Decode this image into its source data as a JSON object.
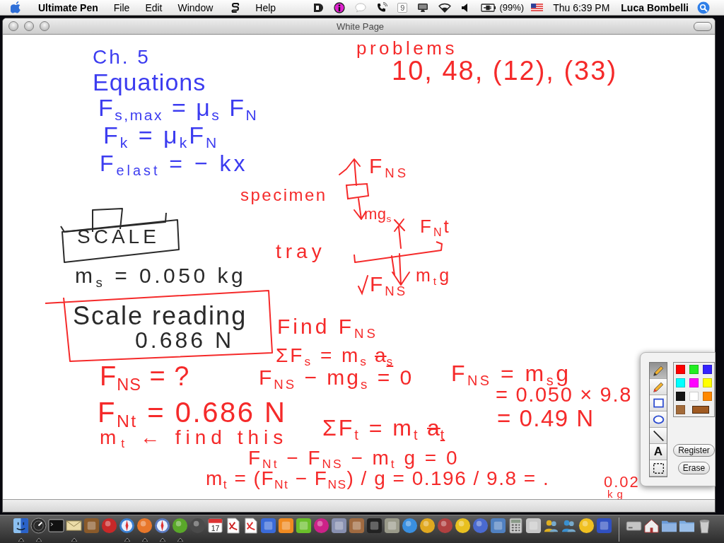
{
  "menu_bar": {
    "app_name": "Ultimate Pen",
    "menus": [
      {
        "kind": "text",
        "label": "File"
      },
      {
        "kind": "text",
        "label": "Edit"
      },
      {
        "kind": "text",
        "label": "Window"
      },
      {
        "kind": "script"
      },
      {
        "kind": "text",
        "label": "Help"
      }
    ],
    "status_items": [
      {
        "kind": "tab"
      },
      {
        "kind": "info"
      },
      {
        "kind": "bubble"
      },
      {
        "kind": "phone"
      },
      {
        "kind": "number",
        "glyph": "9"
      },
      {
        "kind": "display"
      },
      {
        "kind": "wifi"
      },
      {
        "kind": "volume"
      },
      {
        "kind": "battery",
        "label": "(99%)"
      },
      {
        "kind": "flag"
      }
    ],
    "clock": "Thu 6:39 PM",
    "user": "Luca Bombelli"
  },
  "window": {
    "title": "White Page"
  },
  "whiteboard": {
    "notes": [
      {
        "text": "Ch. 5",
        "color": "#3c3cf0",
        "struck": false
      },
      {
        "text": "problems",
        "color": "#f52a2a",
        "struck": false
      },
      {
        "text": "Equations",
        "color": "#3c3cf0",
        "struck": false
      },
      {
        "text": "10, 48, (12), (33)",
        "color": "#f52a2a",
        "struck": false
      },
      {
        "text": "F$_{s,max}$ = μ$_{s}$ F$_{N}$",
        "color": "#3c3cf0",
        "struck": false
      },
      {
        "text": "F$_{k}$ = μ$_{k}$F$_{N}$",
        "color": "#3c3cf0",
        "struck": false
      },
      {
        "text": "F$_{elast}$ = − kx",
        "color": "#3c3cf0",
        "struck": false
      },
      {
        "text": "F$_{NS}$",
        "color": "#f52a2a",
        "struck": false
      },
      {
        "text": "specimen",
        "color": "#f52a2a",
        "struck": false
      },
      {
        "text": "mg$_{s}$",
        "color": "#f52a2a",
        "struck": false
      },
      {
        "text": "SCALE",
        "color": "#2a2a2a",
        "struck": false
      },
      {
        "text": "F$_{N}$t",
        "color": "#f52a2a",
        "struck": false
      },
      {
        "text": "tray",
        "color": "#f52a2a",
        "struck": false
      },
      {
        "text": "m$_{s}$ = 0.050 kg",
        "color": "#2a2a2a",
        "struck": false
      },
      {
        "text": "F$_{NS}$",
        "color": "#f52a2a",
        "struck": false
      },
      {
        "text": "m$_{t}$g",
        "color": "#f52a2a",
        "struck": false
      },
      {
        "text": "Scale reading",
        "color": "#2a2a2a",
        "struck": false
      },
      {
        "text": "0.686 N",
        "color": "#2a2a2a",
        "struck": false
      },
      {
        "text": "Find F$_{NS}$",
        "color": "#f52a2a",
        "struck": false
      },
      {
        "text": "F$_{NS}$ = ?",
        "color": "#f52a2a",
        "struck": false
      },
      {
        "text": "ΣF$_{s}$ = m$_{s}$",
        "color": "#f52a2a",
        "struck": false
      },
      {
        "text": "a$_{s}$",
        "color": "#f52a2a",
        "struck": true
      },
      {
        "text": "F$_{NS}$ − mg$_{s}$ = 0",
        "color": "#f52a2a",
        "struck": false
      },
      {
        "text": "F$_{NS}$ = m$_{s}$g",
        "color": "#f52a2a",
        "struck": false
      },
      {
        "text": "F$_{Nt}$ = 0.686 N",
        "color": "#f52a2a",
        "struck": false
      },
      {
        "text": "= 0.050 × 9.8",
        "color": "#f52a2a",
        "struck": false
      },
      {
        "text": "m$_{t}$ ← find this",
        "color": "#f52a2a",
        "struck": false
      },
      {
        "text": "ΣF$_{t}$ = m$_{t}$",
        "color": "#f52a2a",
        "struck": false
      },
      {
        "text": "a$_{t}$",
        "color": "#f52a2a",
        "struck": true
      },
      {
        "text": "= 0.49 N",
        "color": "#f52a2a",
        "struck": false
      },
      {
        "text": "F$_{Nt}$ − F$_{NS}$ − m$_{t}$ g = 0",
        "color": "#f52a2a",
        "struck": false
      },
      {
        "text": "m$_{t}$ = (F$_{Nt}$ − F$_{NS}$) / g = 0.196 / 9.8 = .",
        "color": "#f52a2a",
        "struck": false
      },
      {
        "text": "0.02",
        "color": "#f52a2a",
        "struck": false
      },
      {
        "text": "kg",
        "color": "#f52a2a",
        "struck": false
      }
    ]
  },
  "tool_palette": {
    "tools": [
      {
        "kind": "pencil",
        "selected": true
      },
      {
        "kind": "crayon",
        "selected": false
      },
      {
        "kind": "rectangle",
        "selected": false
      },
      {
        "kind": "oval",
        "selected": false
      },
      {
        "kind": "line",
        "selected": false
      },
      {
        "kind": "text",
        "glyph": "A",
        "selected": false
      },
      {
        "kind": "marquee",
        "selected": false
      }
    ],
    "colors": [
      {
        "kind": "swatch",
        "color": "#ff0000"
      },
      {
        "kind": "swatch",
        "color": "#22ee22"
      },
      {
        "kind": "swatch",
        "color": "#3322ff"
      },
      {
        "kind": "swatch",
        "color": "#00ffff"
      },
      {
        "kind": "swatch",
        "color": "#ff00ff"
      },
      {
        "kind": "swatch",
        "color": "#ffff00"
      },
      {
        "kind": "swatch",
        "color": "#151515"
      },
      {
        "kind": "swatch",
        "color": "#ffffff"
      },
      {
        "kind": "swatch",
        "color": "#ff8800"
      },
      {
        "kind": "swatch",
        "color": "#a36b3a"
      },
      {
        "kind": "bar",
        "color": "#a05a22"
      }
    ],
    "buttons": [
      {
        "label": "Register"
      },
      {
        "label": "Erase"
      }
    ]
  },
  "dock": {
    "apps": [
      {
        "kind": "face",
        "running": true
      },
      {
        "kind": "dial",
        "running": true
      },
      {
        "kind": "terminal",
        "running": false
      },
      {
        "kind": "envelope",
        "running": true
      },
      {
        "kind": "tile",
        "color": "#8a5a2a",
        "running": false
      },
      {
        "kind": "disc",
        "color": "#c82828",
        "running": false
      },
      {
        "kind": "compass",
        "color": "#3a7fd0",
        "running": true
      },
      {
        "kind": "disc",
        "color": "#e8772a",
        "running": true
      },
      {
        "kind": "compass",
        "color": "#5a7ac0",
        "running": true
      },
      {
        "kind": "disc",
        "color": "#5aa82a",
        "running": true
      },
      {
        "kind": "disc",
        "color": "#4a4a4a",
        "running": false
      },
      {
        "kind": "calendar",
        "label": "17",
        "running": false
      },
      {
        "kind": "document",
        "color": "#cc2020",
        "running": false
      },
      {
        "kind": "document",
        "color": "#e03030",
        "running": false
      },
      {
        "kind": "tile",
        "color": "#3a6ad8",
        "running": false
      },
      {
        "kind": "tile",
        "color": "#f08a20",
        "running": false
      },
      {
        "kind": "tile",
        "color": "#6abf2a",
        "running": false
      },
      {
        "kind": "disc",
        "color": "#cc2288",
        "running": false
      },
      {
        "kind": "tile",
        "color": "#8890b0",
        "running": false
      },
      {
        "kind": "tile",
        "color": "#a06a40",
        "running": false
      },
      {
        "kind": "tile",
        "color": "#222222",
        "running": false
      },
      {
        "kind": "tile",
        "color": "#9a9a8a",
        "running": false
      },
      {
        "kind": "disc",
        "color": "#3a8fe0",
        "running": false
      },
      {
        "kind": "disc",
        "color": "#e0a820",
        "running": false
      },
      {
        "kind": "disc",
        "color": "#b04040",
        "running": false
      },
      {
        "kind": "disc",
        "color": "#e8c020",
        "running": false
      },
      {
        "kind": "disc",
        "color": "#4a6ad0",
        "running": false
      },
      {
        "kind": "tile",
        "color": "#5080c0",
        "running": false
      },
      {
        "kind": "calculator",
        "running": false
      },
      {
        "kind": "tile",
        "color": "#c8c8c8",
        "running": false
      },
      {
        "kind": "people",
        "color": "#e0b020",
        "running": false
      },
      {
        "kind": "people",
        "color": "#3a90d0",
        "running": false
      },
      {
        "kind": "disc",
        "color": "#f0c020",
        "running": false
      },
      {
        "kind": "tile",
        "color": "#3050c0",
        "running": false
      }
    ],
    "places": [
      {
        "kind": "drive"
      },
      {
        "kind": "house"
      },
      {
        "kind": "folder",
        "color": "#6a9ad8"
      },
      {
        "kind": "folder",
        "color": "#7aaae0"
      },
      {
        "kind": "trash"
      }
    ]
  }
}
